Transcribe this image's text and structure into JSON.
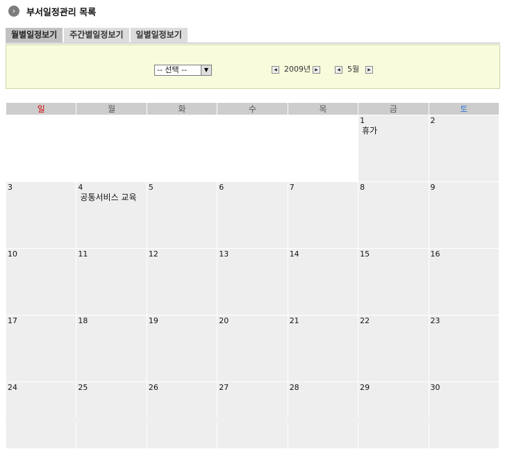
{
  "header": {
    "title": "부서일정관리 목록",
    "icon": "circle-chevron-right-icon"
  },
  "tabs": [
    {
      "label": "월별일정보기",
      "active": true
    },
    {
      "label": "주간별일정보기",
      "active": false
    },
    {
      "label": "일별일정보기",
      "active": false
    }
  ],
  "filter": {
    "select_value": "-- 선택 --",
    "year_label": "2009년",
    "month_label": "5월"
  },
  "calendar": {
    "weekdays": [
      "일",
      "월",
      "화",
      "수",
      "목",
      "금",
      "토"
    ],
    "colors": {
      "sunday": "#d40000",
      "saturday": "#3a7bd5",
      "header_bg": "#cdcdcd",
      "cell_bg": "#eeeeee",
      "panel_bg": "#f8fbdc"
    },
    "weeks": [
      [
        {},
        {},
        {},
        {},
        {},
        {
          "day": "1",
          "event": "휴가"
        },
        {
          "day": "2"
        }
      ],
      [
        {
          "day": "3"
        },
        {
          "day": "4",
          "event": "공통서비스 교육"
        },
        {
          "day": "5"
        },
        {
          "day": "6"
        },
        {
          "day": "7"
        },
        {
          "day": "8"
        },
        {
          "day": "9"
        }
      ],
      [
        {
          "day": "10"
        },
        {
          "day": "11"
        },
        {
          "day": "12"
        },
        {
          "day": "13"
        },
        {
          "day": "14"
        },
        {
          "day": "15"
        },
        {
          "day": "16"
        }
      ],
      [
        {
          "day": "17"
        },
        {
          "day": "18"
        },
        {
          "day": "19"
        },
        {
          "day": "20"
        },
        {
          "day": "21"
        },
        {
          "day": "22"
        },
        {
          "day": "23"
        }
      ],
      [
        {
          "day": "24"
        },
        {
          "day": "25"
        },
        {
          "day": "26"
        },
        {
          "day": "27"
        },
        {
          "day": "28"
        },
        {
          "day": "29"
        },
        {
          "day": "30"
        }
      ]
    ]
  }
}
